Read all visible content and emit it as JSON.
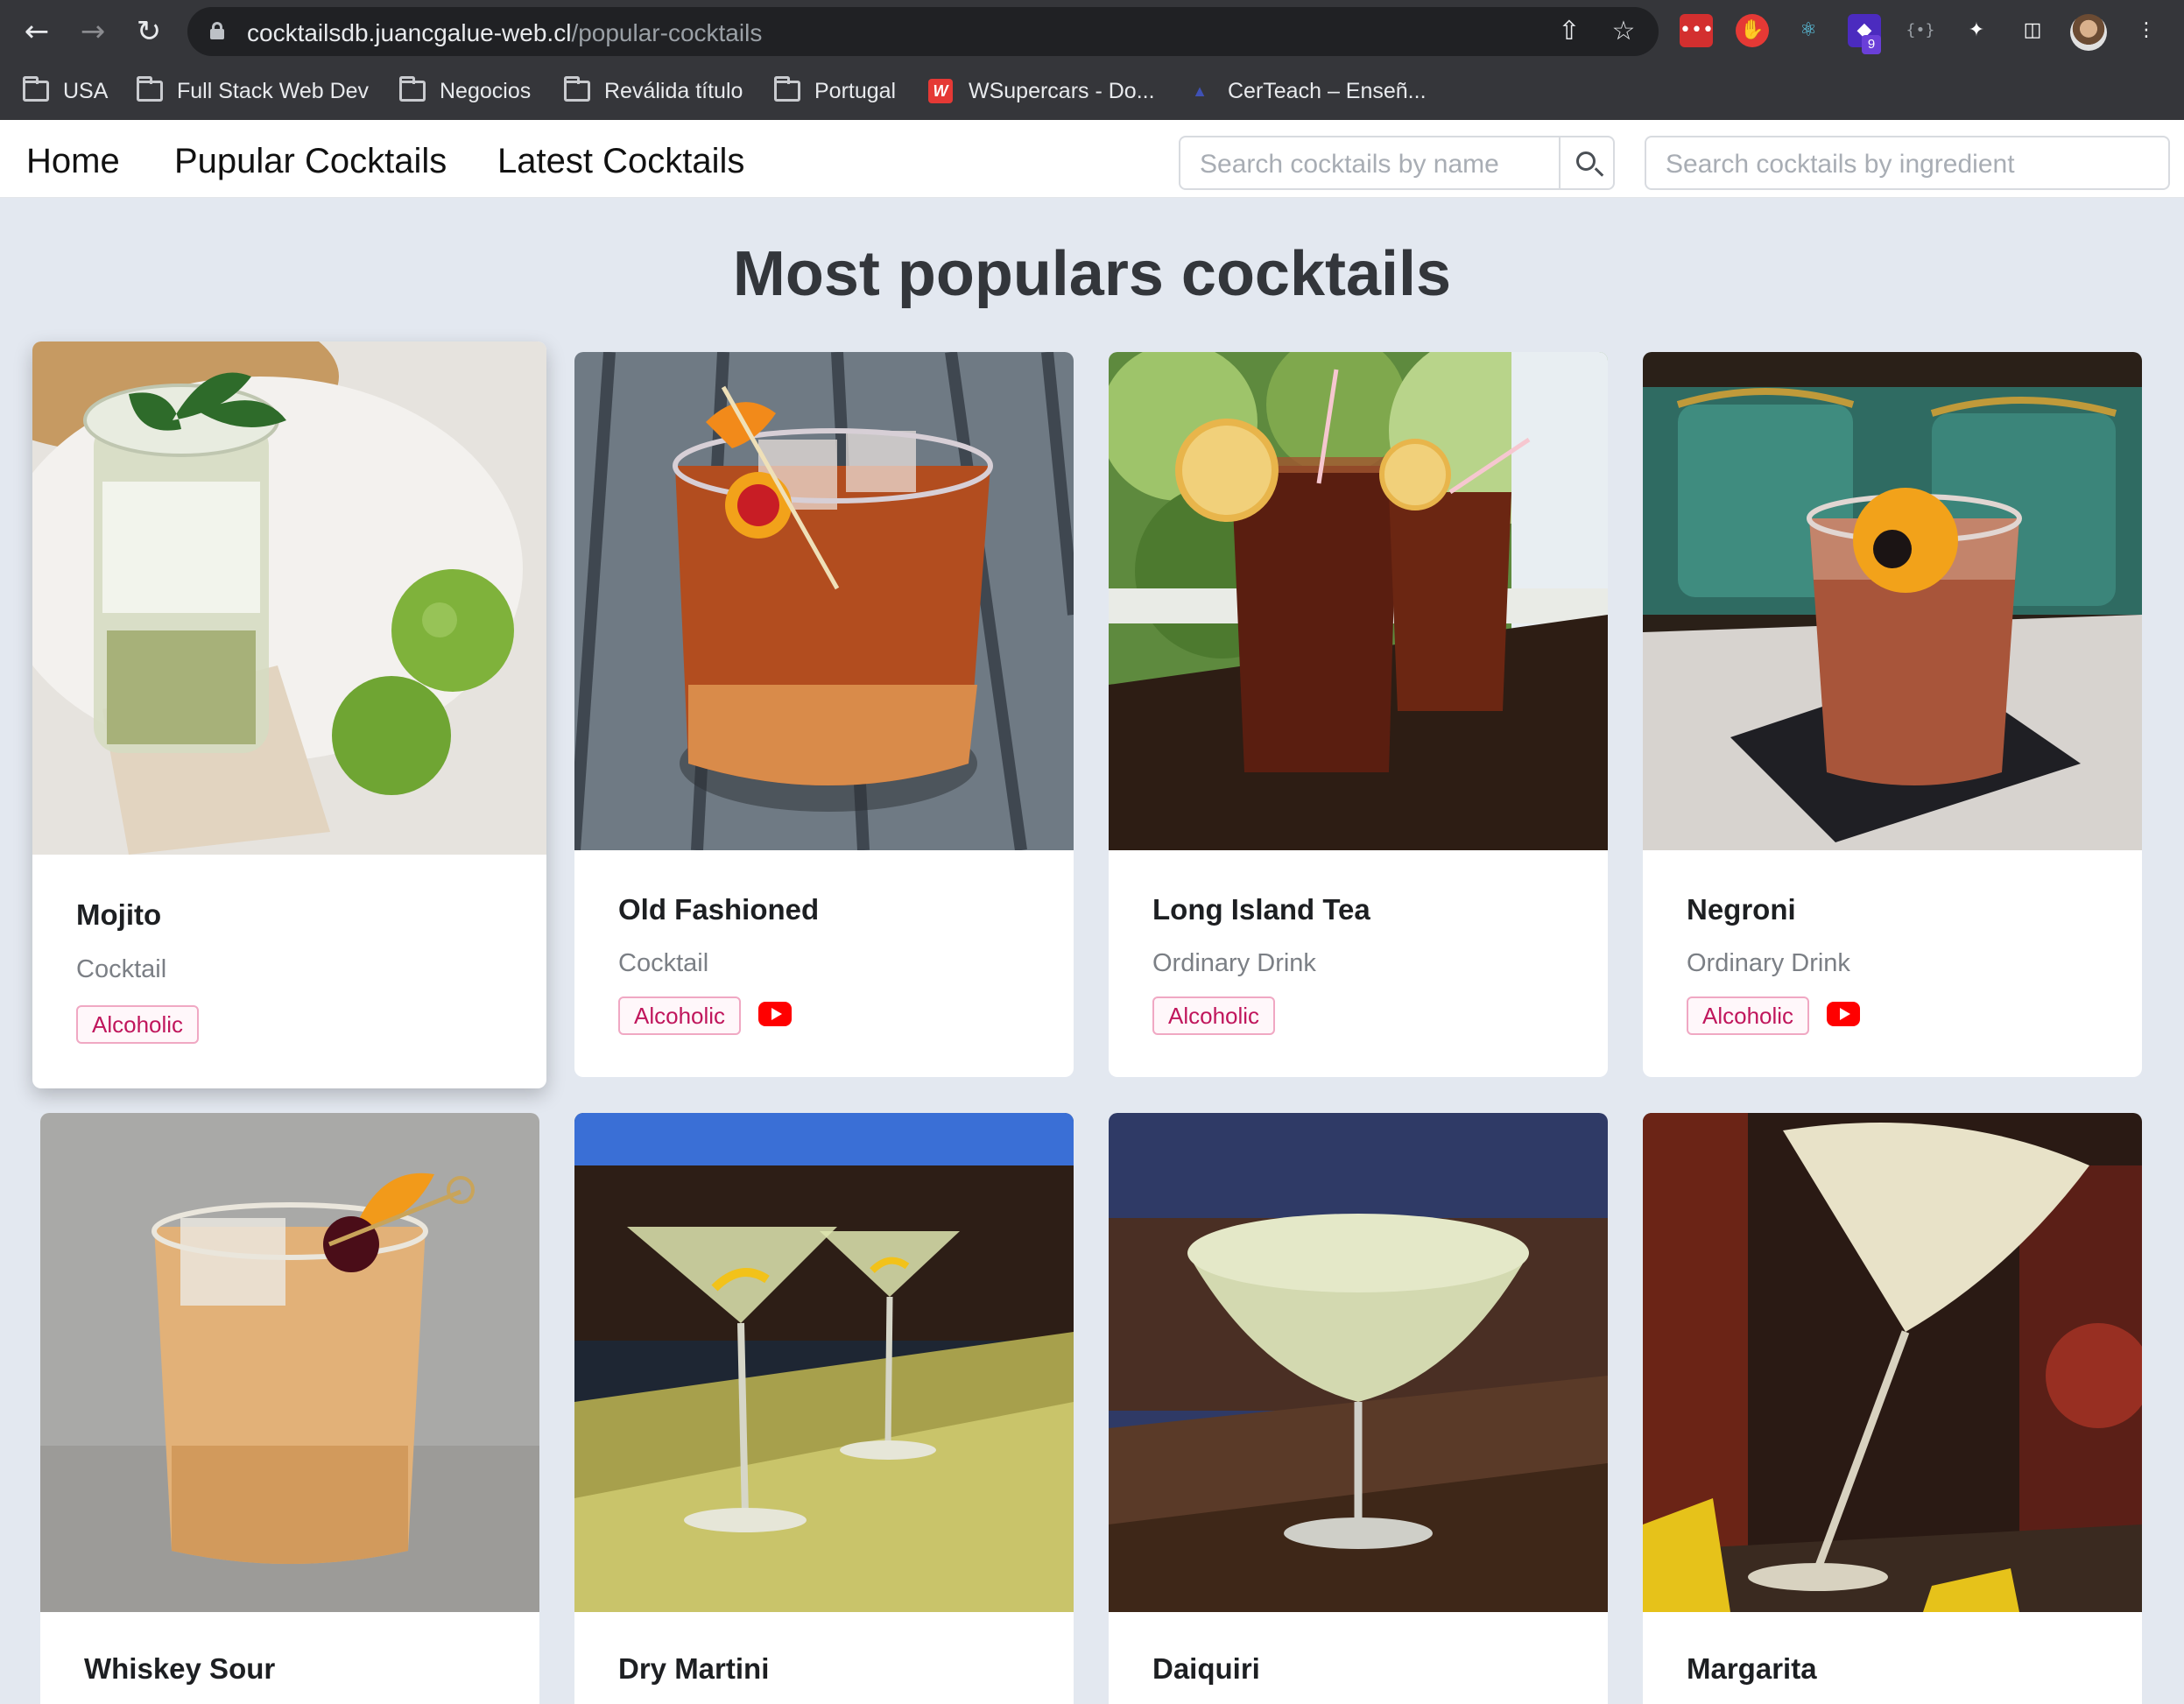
{
  "browser": {
    "url_host": "cocktailsdb.juancgalue-web.cl",
    "url_path": "/popular-cocktails",
    "extension_badge": "9",
    "bookmarks": [
      {
        "label": "USA",
        "icon": "folder-icon"
      },
      {
        "label": "Full Stack Web Dev",
        "icon": "folder-icon"
      },
      {
        "label": "Negocios",
        "icon": "folder-icon"
      },
      {
        "label": "Reválida título",
        "icon": "folder-icon"
      },
      {
        "label": "Portugal",
        "icon": "folder-icon"
      },
      {
        "label": "WSupercars - Do...",
        "icon": "wsupercars-icon"
      },
      {
        "label": "CerTeach – Enseñ...",
        "icon": "certeach-icon"
      }
    ]
  },
  "nav": {
    "home": "Home",
    "popular": "Pupular Cocktails",
    "latest": "Latest Cocktails",
    "search_name_placeholder": "Search cocktails by name",
    "search_ingredient_placeholder": "Search cocktails by ingredient"
  },
  "page": {
    "title": "Most populars cocktails"
  },
  "cocktails": [
    {
      "name": "Mojito",
      "category": "Cocktail",
      "tag": "Alcoholic",
      "video": false,
      "icon": "mojito-photo"
    },
    {
      "name": "Old Fashioned",
      "category": "Cocktail",
      "tag": "Alcoholic",
      "video": true,
      "icon": "old-fashioned-photo"
    },
    {
      "name": "Long Island Tea",
      "category": "Ordinary Drink",
      "tag": "Alcoholic",
      "video": false,
      "icon": "long-island-tea-photo"
    },
    {
      "name": "Negroni",
      "category": "Ordinary Drink",
      "tag": "Alcoholic",
      "video": true,
      "icon": "negroni-photo"
    },
    {
      "name": "Whiskey Sour",
      "icon": "whiskey-sour-photo"
    },
    {
      "name": "Dry Martini",
      "icon": "dry-martini-photo"
    },
    {
      "name": "Daiquiri",
      "icon": "daiquiri-photo"
    },
    {
      "name": "Margarita",
      "icon": "margarita-photo"
    }
  ],
  "colors": {
    "page_bg": "#e3e8f0",
    "tag_text": "#c0165c",
    "tag_border": "#f0a8c3",
    "youtube": "#ff0000"
  }
}
